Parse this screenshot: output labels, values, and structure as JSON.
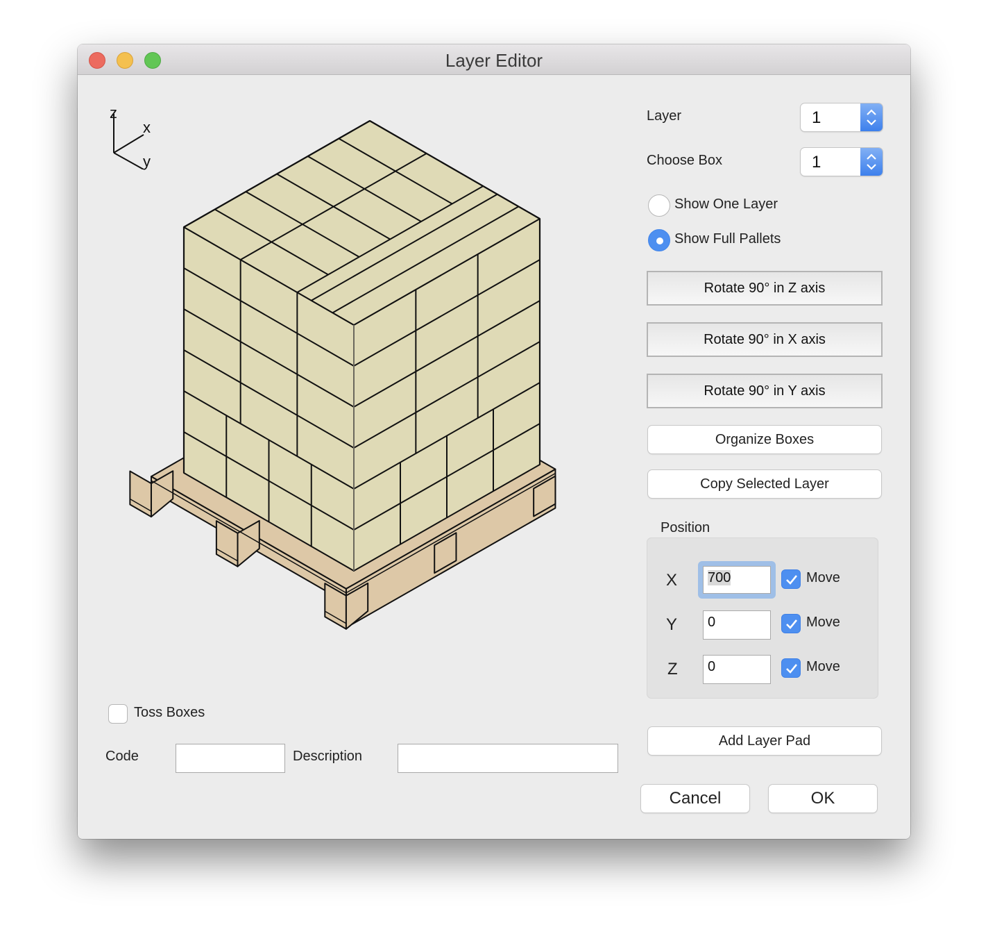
{
  "window": {
    "title": "Layer Editor",
    "traffic_lights": [
      "close",
      "minimize",
      "zoom"
    ]
  },
  "viewport": {
    "axis_labels": {
      "z": "z",
      "x": "x",
      "y": "y"
    },
    "colors": {
      "box_fill": "#dfdab6",
      "box_edge": "#111111",
      "pallet_fill": "#ddc8a7",
      "hidden_edge": "#a7a390"
    },
    "stack": {
      "layers": 6,
      "description": "Isometric full pallet view: 6 layers of boxes on a wooden pallet"
    }
  },
  "controls": {
    "layer": {
      "label": "Layer",
      "value": "1"
    },
    "choose_box": {
      "label": "Choose Box",
      "value": "1"
    },
    "view_mode": {
      "options": [
        {
          "label": "Show One Layer",
          "selected": false
        },
        {
          "label": "Show Full Pallets",
          "selected": true
        }
      ]
    },
    "rotate_z": "Rotate 90° in Z axis",
    "rotate_x": "Rotate 90° in X axis",
    "rotate_y": "Rotate 90° in Y axis",
    "organize": "Organize Boxes",
    "copy_layer": "Copy Selected Layer",
    "position": {
      "title": "Position",
      "rows": [
        {
          "axis": "X",
          "value": "700",
          "move_label": "Move",
          "move_checked": true
        },
        {
          "axis": "Y",
          "value": "0",
          "move_label": "Move",
          "move_checked": true
        },
        {
          "axis": "Z",
          "value": "0",
          "move_label": "Move",
          "move_checked": true
        }
      ]
    },
    "add_layer_pad": "Add Layer Pad",
    "cancel": "Cancel",
    "ok": "OK"
  },
  "bottom": {
    "toss_boxes": {
      "label": "Toss Boxes",
      "checked": false
    },
    "code": {
      "label": "Code",
      "value": ""
    },
    "description": {
      "label": "Description",
      "value": ""
    }
  }
}
